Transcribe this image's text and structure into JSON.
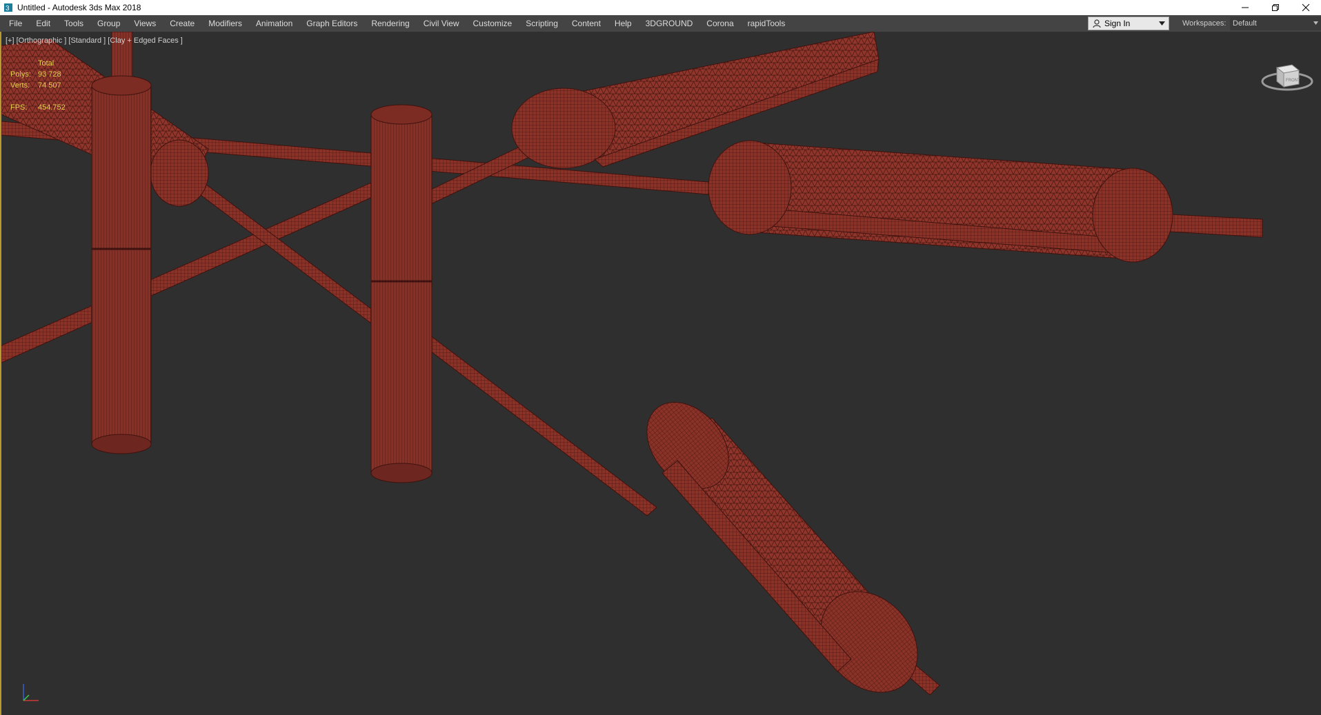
{
  "window": {
    "title": "Untitled - Autodesk 3ds Max 2018",
    "icons": [
      "app-icon",
      "minimize-icon",
      "restore-icon",
      "close-icon"
    ]
  },
  "menubar": {
    "items": [
      "File",
      "Edit",
      "Tools",
      "Group",
      "Views",
      "Create",
      "Modifiers",
      "Animation",
      "Graph Editors",
      "Rendering",
      "Civil View",
      "Customize",
      "Scripting",
      "Content",
      "Help",
      "3DGROUND",
      "Corona",
      "rapidTools"
    ],
    "sign_in": "Sign In",
    "workspaces_label": "Workspaces:",
    "workspace_value": "Default"
  },
  "viewport": {
    "label": "[+] [Orthographic ] [Standard ] [Clay + Edged Faces ]",
    "stats": {
      "total_label": "Total",
      "polys_label": "Polys:",
      "polys_value": "93 728",
      "verts_label": "Verts:",
      "verts_value": "74 507",
      "fps_label": "FPS:",
      "fps_value": "454.752"
    },
    "viewcube_label": "FRONT",
    "colors": {
      "mesh": "#8a3228",
      "mesh_dark": "#5a1c16",
      "wire": "#3e120e",
      "background": "#2f2f2f"
    }
  }
}
